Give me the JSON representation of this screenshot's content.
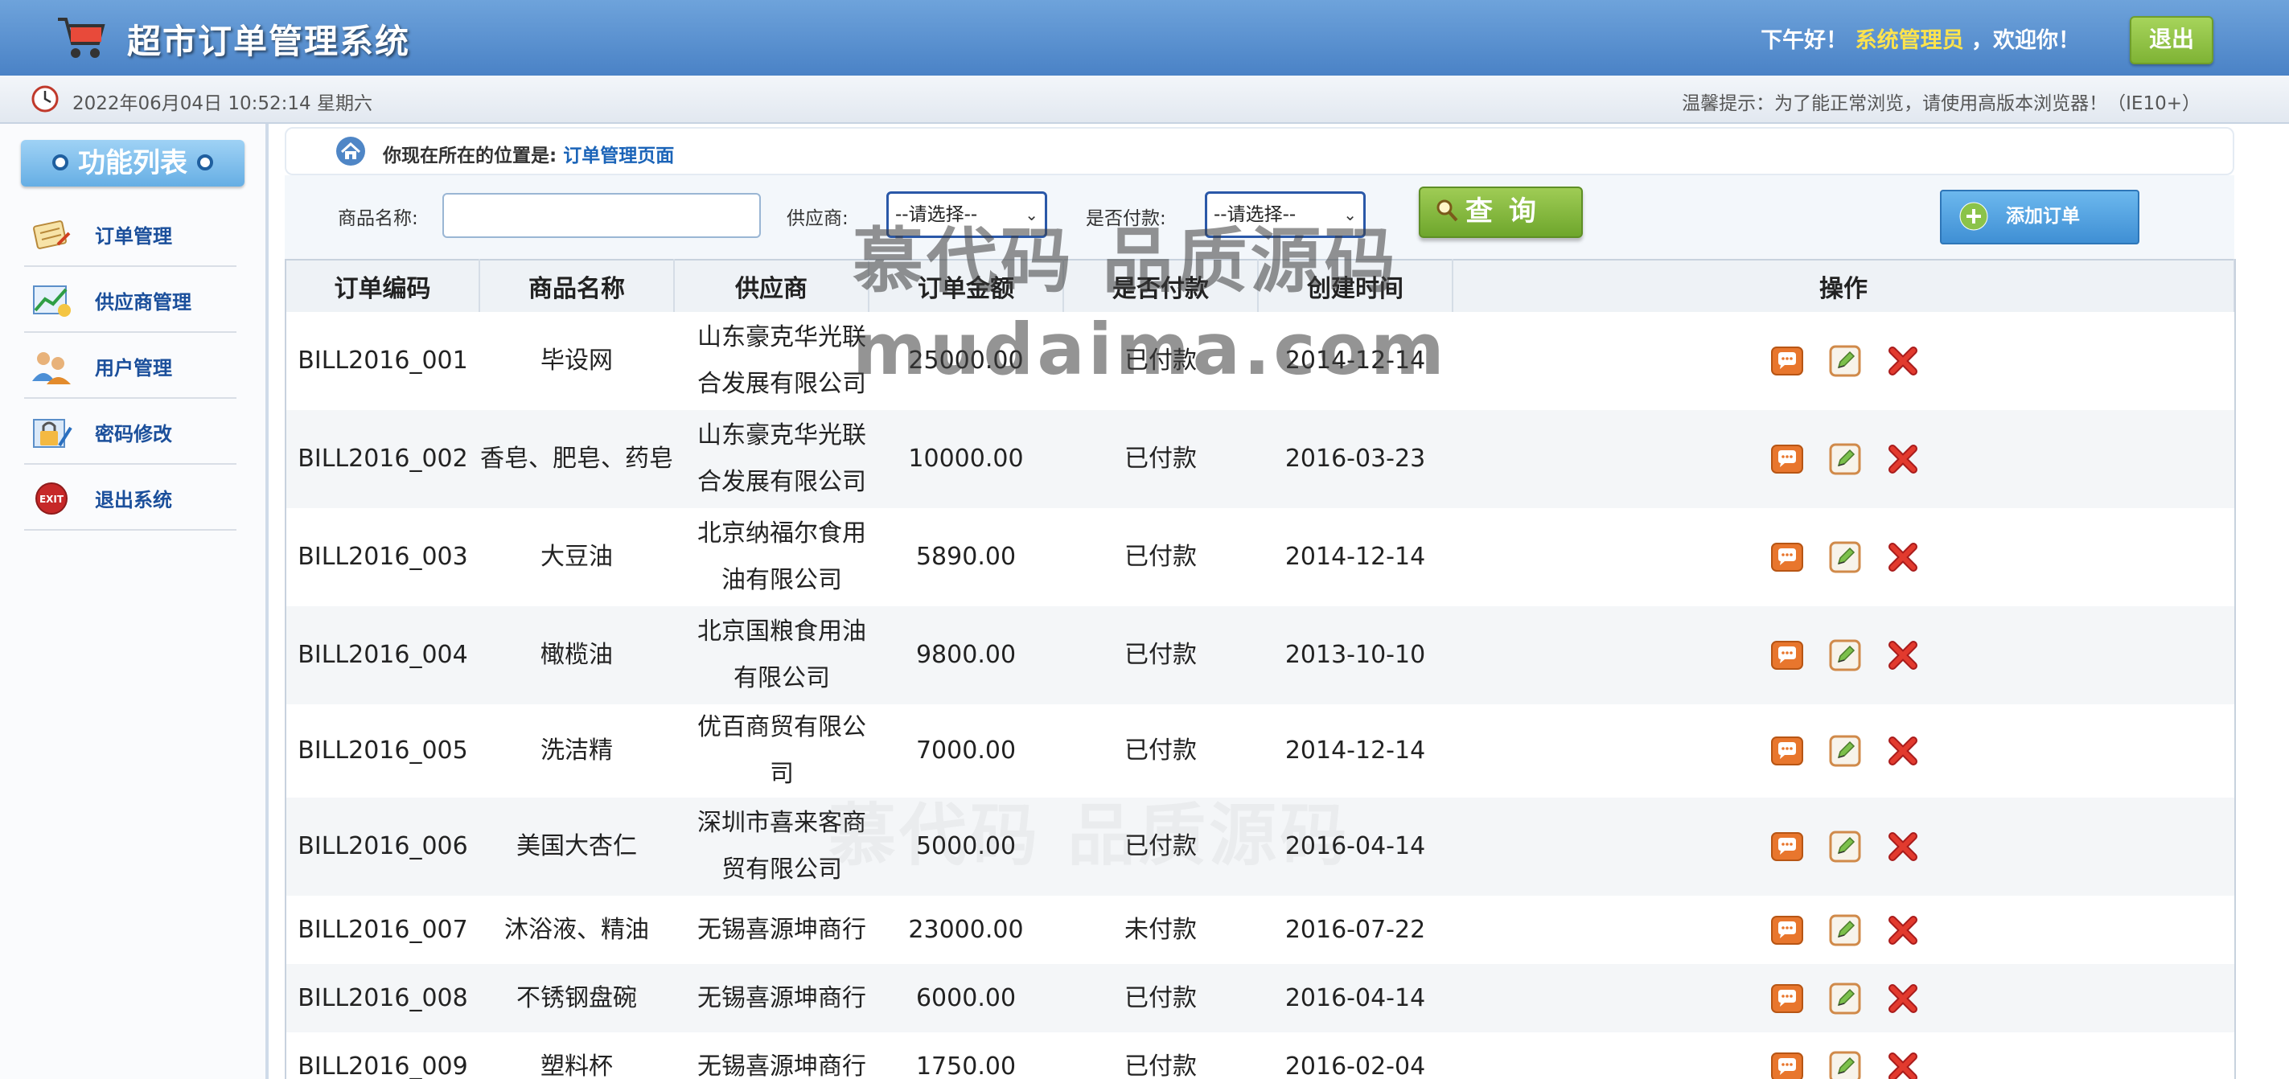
{
  "header": {
    "title": "超市订单管理系统",
    "greeting_prefix": "下午好！",
    "admin_name": "系统管理员",
    "greeting_suffix": "，欢迎你！",
    "logout_label": "退出"
  },
  "infobar": {
    "datetime": "2022年06月04日 10:52:14 星期六",
    "tip": "温馨提示：为了能正常浏览，请使用高版本浏览器！（IE10+）"
  },
  "sidebar": {
    "title": "功能列表",
    "items": [
      {
        "label": "订单管理",
        "icon": "order-icon"
      },
      {
        "label": "供应商管理",
        "icon": "provider-icon"
      },
      {
        "label": "用户管理",
        "icon": "users-icon"
      },
      {
        "label": "密码修改",
        "icon": "password-icon"
      },
      {
        "label": "退出系统",
        "icon": "exit-icon"
      }
    ]
  },
  "breadcrumb": {
    "prefix": "你现在所在的位置是:",
    "current": "订单管理页面"
  },
  "search": {
    "product_label": "商品名称:",
    "product_value": "",
    "provider_label": "供应商:",
    "provider_selected": "--请选择--",
    "paid_label": "是否付款:",
    "paid_selected": "--请选择--",
    "query_label": "查 询",
    "add_label": "添加订单"
  },
  "table": {
    "headers": [
      "订单编码",
      "商品名称",
      "供应商",
      "订单金额",
      "是否付款",
      "创建时间",
      "操作"
    ],
    "rows": [
      {
        "code": "BILL2016_001",
        "product": "毕设网",
        "provider": "山东豪克华光联合发展有限公司",
        "amount": "25000.00",
        "paid": "已付款",
        "date": "2014-12-14"
      },
      {
        "code": "BILL2016_002",
        "product": "香皂、肥皂、药皂",
        "provider": "山东豪克华光联合发展有限公司",
        "amount": "10000.00",
        "paid": "已付款",
        "date": "2016-03-23"
      },
      {
        "code": "BILL2016_003",
        "product": "大豆油",
        "provider": "北京纳福尔食用油有限公司",
        "amount": "5890.00",
        "paid": "已付款",
        "date": "2014-12-14"
      },
      {
        "code": "BILL2016_004",
        "product": "橄榄油",
        "provider": "北京国粮食用油有限公司",
        "amount": "9800.00",
        "paid": "已付款",
        "date": "2013-10-10"
      },
      {
        "code": "BILL2016_005",
        "product": "洗洁精",
        "provider": "优百商贸有限公司",
        "amount": "7000.00",
        "paid": "已付款",
        "date": "2014-12-14"
      },
      {
        "code": "BILL2016_006",
        "product": "美国大杏仁",
        "provider": "深圳市喜来客商贸有限公司",
        "amount": "5000.00",
        "paid": "已付款",
        "date": "2016-04-14"
      },
      {
        "code": "BILL2016_007",
        "product": "沐浴液、精油",
        "provider": "无锡喜源坤商行",
        "amount": "23000.00",
        "paid": "未付款",
        "date": "2016-07-22"
      },
      {
        "code": "BILL2016_008",
        "product": "不锈钢盘碗",
        "provider": "无锡喜源坤商行",
        "amount": "6000.00",
        "paid": "已付款",
        "date": "2016-04-14"
      },
      {
        "code": "BILL2016_009",
        "product": "塑料杯",
        "provider": "无锡喜源坤商行",
        "amount": "1750.00",
        "paid": "已付款",
        "date": "2016-02-04"
      }
    ]
  },
  "watermark": {
    "line1": "慕代码 品质源码",
    "line2": "mudaima.com"
  },
  "colors": {
    "header_blue": "#4a82c6",
    "admin_yellow": "#ffe34d",
    "logout_green": "#7fb335",
    "link_blue": "#1b64b8"
  }
}
